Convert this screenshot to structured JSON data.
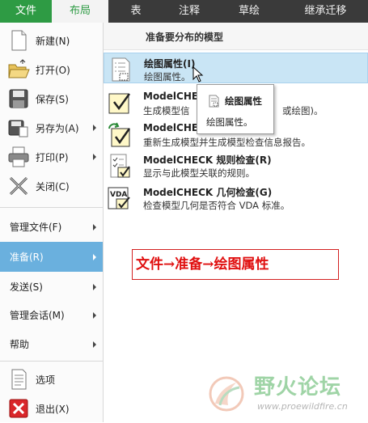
{
  "tabs": [
    {
      "label": "文件"
    },
    {
      "label": "布局"
    },
    {
      "label": "表"
    },
    {
      "label": "注释"
    },
    {
      "label": "草绘"
    },
    {
      "label": "继承迁移"
    }
  ],
  "left_menu": {
    "new": "新建(N)",
    "open": "打开(O)",
    "save": "保存(S)",
    "save_as": "另存为(A)",
    "print": "打印(P)",
    "close": "关闭(C)",
    "manage_file": "管理文件(F)",
    "prepare": "准备(R)",
    "send": "发送(S)",
    "manage_session": "管理会话(M)",
    "help": "帮助",
    "options": "选项",
    "exit": "退出(X)"
  },
  "panel": {
    "heading": "准备要分布的模型",
    "items": [
      {
        "title": "绘图属性(I)",
        "desc": "绘图属性。"
      },
      {
        "title": "ModelCHEC",
        "desc": "生成模型信",
        "desc_tail": "或绘图)。"
      },
      {
        "title": "ModelCHEC",
        "desc": "重新生成模型并生成模型检查信息报告。"
      },
      {
        "title": "ModelCHECK 规则检查(R)",
        "desc": "显示与此模型关联的规则。"
      },
      {
        "title": "ModelCHECK 几何检查(G)",
        "desc": "检查模型几何是否符合 VDA 标准。"
      }
    ]
  },
  "tooltip": {
    "title": "绘图属性",
    "desc": "绘图属性。"
  },
  "annotation": "文件→准备→绘图属性",
  "watermark": {
    "title": "野火论坛",
    "url": "www.proewildfire.cn"
  },
  "icons": {
    "vda_label": "VDA"
  },
  "colors": {
    "file_tab": "#2e9b44",
    "tab_bar": "#3a3a3a",
    "active_section": "#6ab0de",
    "highlight_row": "#c9e5f5",
    "annotation_red": "#e01010"
  }
}
